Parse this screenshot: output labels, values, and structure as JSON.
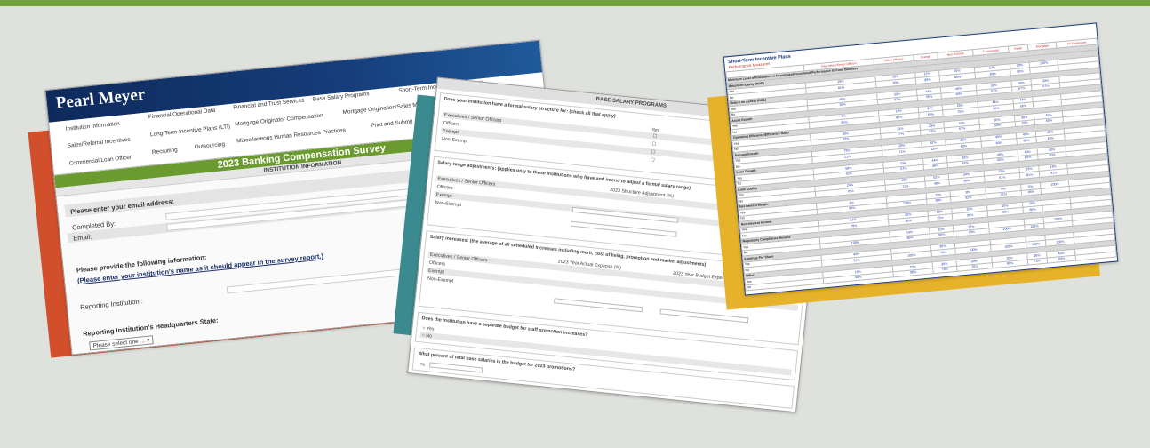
{
  "institution_info": {
    "logo": "Pearl Meyer",
    "tabs": [
      "Institution Information",
      "Financial/Operational Data",
      "Financial and Trust Services",
      "Base Salary Programs",
      "Short-Term Incentive/Bonus Plans",
      "Sales/Referral Incentives",
      "Long-Term Incentive Plans (LTI)",
      "Mortgage Originator Compensation",
      "Mortgage Origination/Sales Manager Comp",
      "Commercial Loan Officer",
      "Recruiting",
      "Outsourcing",
      "Miscellaneous Human Resources Practices",
      "Print and Submit"
    ],
    "banner": "2023 Banking Compensation Survey",
    "subtitle": "INSTITUTION INFORMATION",
    "email_prompt": "Please enter your email address:",
    "completed_by_label": "Completed By:",
    "email_label": "Email:",
    "info_prompt": "Please provide the following information:",
    "info_note": "(Please enter your institution's name as it should appear in the survey report.)",
    "reporting_institution_label": "Reporting Institution :",
    "hq_state_label": "Reporting Institution's Headquarters State:",
    "state_select": "Please select one ..."
  },
  "base_salary": {
    "title": "BASE SALARY PROGRAMS",
    "q1": "Does your institution have a formal salary structure for: (check all that apply)",
    "q1_col": "Yes",
    "q1_rows": [
      "Executives / Senior Officers",
      "Officers",
      "Exempt",
      "Non-Exempt"
    ],
    "q2": "Salary range adjustments: (applies only to those institutions who have and intend to adjust a formal salary range)",
    "q2_col": "2023 Structure Adjustment (%)",
    "q2_rows": [
      "Executives / Senior Officers",
      "Officers",
      "Exempt",
      "Non-Exempt"
    ],
    "q3": "Salary increases: (the average of all scheduled increases including merit, cost of living, promotion and market adjustments)",
    "q3_col1": "2023 Year Actual Expense (%)",
    "q3_col2": "2023 Year Budget Expense (%)",
    "q3_rows": [
      "Executives / Senior Officers",
      "Officers",
      "Exempt",
      "Non-Exempt"
    ],
    "q4": "Does the institution have a separate budget for staff promotion increases?",
    "q4_options": [
      "Yes",
      "No"
    ],
    "q5": "What percent of total base salaries is the budget for 2023 promotions?",
    "q5_unit": "%"
  },
  "short_term": {
    "title": "Short-Term Incentive Plans",
    "subtitle": "Performance Measures",
    "col_headers": [
      "Executives/Senior Officers",
      "Other Officers",
      "Exempt",
      "Non-Exempt",
      "Commercial",
      "Retail",
      "Mortgage",
      "All Employees"
    ],
    "rows": [
      {
        "label": "Minimum Level of Institution or Department/Functional Performance to Fund Bonuses",
        "section": true
      },
      {
        "label": "Return on Equity (ROE)",
        "section": true
      },
      {
        "label": "Yes",
        "vals": [
          "19%",
          "10%",
          "11%",
          "20%",
          "17%",
          "20%",
          "100%"
        ]
      },
      {
        "label": "No",
        "vals": [
          "81%",
          "90%",
          "89%",
          "80%",
          "83%",
          "80%",
          ""
        ]
      },
      {
        "label": "Return on Assets (ROA)",
        "section": true
      },
      {
        "label": "Yes",
        "vals": [
          "40%",
          "33%",
          "44%",
          "40%",
          "33%",
          "33%",
          "33%"
        ]
      },
      {
        "label": "No",
        "vals": [
          "60%",
          "67%",
          "56%",
          "60%",
          "67%",
          "67%",
          "67%"
        ]
      },
      {
        "label": "Asset Growth",
        "section": true
      },
      {
        "label": "Yes",
        "vals": [
          "5%",
          "13%",
          "34%",
          "25%",
          "44%",
          "44%",
          ""
        ]
      },
      {
        "label": "No",
        "vals": [
          "95%",
          "87%",
          "66%",
          "75%",
          "56%",
          "56%",
          ""
        ]
      },
      {
        "label": "Operating Efficiency/Efficiency Ratio",
        "section": true
      },
      {
        "label": "Yes",
        "vals": [
          "40%",
          "23%",
          "33%",
          "33%",
          "50%",
          "30%",
          "40%"
        ]
      },
      {
        "label": "No",
        "vals": [
          "60%",
          "77%",
          "67%",
          "67%",
          "50%",
          "70%",
          "60%"
        ]
      },
      {
        "label": "Deposit Growth",
        "section": true
      },
      {
        "label": "Yes",
        "vals": [
          "79%",
          "29%",
          "87%",
          "40%",
          "40%",
          "40%",
          "40%"
        ]
      },
      {
        "label": "No",
        "vals": [
          "21%",
          "71%",
          "13%",
          "60%",
          "60%",
          "60%",
          "60%"
        ]
      },
      {
        "label": "Loan Growth",
        "section": true
      },
      {
        "label": "Yes",
        "vals": [
          "58%",
          "33%",
          "44%",
          "33%",
          "40%",
          "40%",
          "40%"
        ]
      },
      {
        "label": "No",
        "vals": [
          "42%",
          "67%",
          "56%",
          "67%",
          "60%",
          "60%",
          "60%"
        ]
      },
      {
        "label": "Loan Quality",
        "section": true
      },
      {
        "label": "Yes",
        "vals": [
          "24%",
          "29%",
          "52%",
          "34%",
          "33%",
          "19%",
          "19%"
        ]
      },
      {
        "label": "No",
        "vals": [
          "76%",
          "71%",
          "48%",
          "66%",
          "67%",
          "81%",
          "81%"
        ]
      },
      {
        "label": "Net Interest Margin",
        "section": true
      },
      {
        "label": "Yes",
        "vals": [
          "6%",
          "",
          "11%",
          "8%",
          "9%",
          "6%",
          "100%"
        ]
      },
      {
        "label": "No",
        "vals": [
          "94%",
          "100%",
          "89%",
          "92%",
          "91%",
          "94%",
          ""
        ]
      },
      {
        "label": "Non-Interest Income",
        "section": true
      },
      {
        "label": "Yes",
        "vals": [
          "21%",
          "20%",
          "25%",
          "10%",
          "10%",
          "20%",
          ""
        ]
      },
      {
        "label": "No",
        "vals": [
          "79%",
          "80%",
          "75%",
          "90%",
          "90%",
          "80%",
          ""
        ]
      },
      {
        "label": "Regulatory Compliance Results",
        "section": true
      },
      {
        "label": "Yes",
        "vals": [
          "",
          "14%",
          "10%",
          "27%",
          "",
          "",
          "100%"
        ]
      },
      {
        "label": "No",
        "vals": [
          "100%",
          "86%",
          "90%",
          "73%",
          "100%",
          "100%",
          ""
        ]
      },
      {
        "label": "Earnings Per Share",
        "section": true
      },
      {
        "label": "Yes",
        "vals": [
          "43%",
          "",
          "30%",
          "",
          "",
          "",
          ""
        ]
      },
      {
        "label": "No",
        "vals": [
          "57%",
          "100%",
          "70%",
          "100%",
          "100%",
          "100%",
          "100%"
        ]
      },
      {
        "label": "Other",
        "section": true
      },
      {
        "label": "Yes",
        "vals": [
          "10%",
          "10%",
          "30%",
          "30%",
          "20%",
          "30%",
          "40%"
        ]
      },
      {
        "label": "No",
        "vals": [
          "90%",
          "90%",
          "70%",
          "70%",
          "80%",
          "70%",
          "60%"
        ]
      }
    ]
  },
  "colors": {
    "top_bar": "#74a23b",
    "orange": "#d24f2c",
    "teal": "#3b8a8f",
    "gold": "#e5b22a",
    "navy": "#0e2a5c"
  }
}
